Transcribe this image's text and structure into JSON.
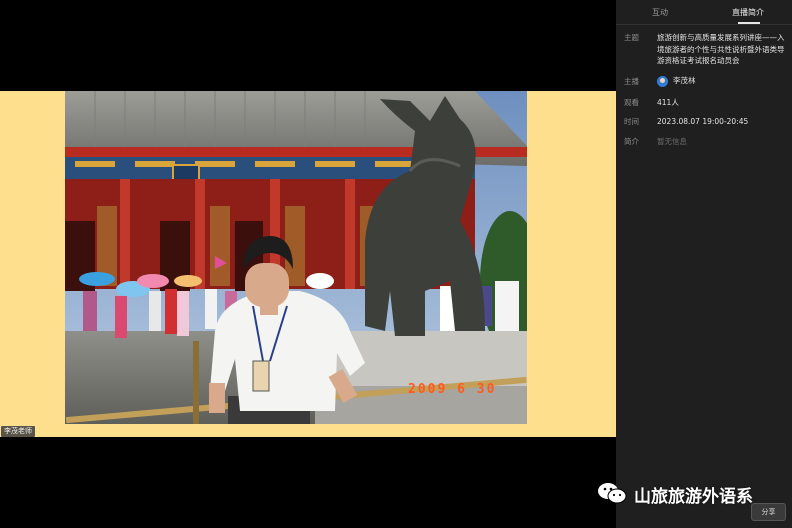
{
  "tabs": [
    {
      "label": "互动"
    },
    {
      "label": "直播简介"
    }
  ],
  "info": {
    "topic_label": "主题",
    "topic_value": "旅游创新与高质量发展系列讲座——入境旅游者的个性与共性说析暨外语类导游资格证考试报名动员会",
    "host_label": "主播",
    "host_value": "李茂林",
    "views_label": "观看",
    "views_value": "411人",
    "time_label": "时间",
    "time_value": "2023.08.07 19:00-20:45",
    "intro_label": "简介",
    "intro_value": "暂无信息"
  },
  "presenter_label": "李茂老师",
  "photo_date_stamp": "2009 6 30",
  "watermark_text": "山旅旅游外语系",
  "share_label": "分享",
  "colors": {
    "slide_background": "#fedf8e",
    "panel_background": "#1f1f1f",
    "date_stamp": "#ff5a1f"
  }
}
